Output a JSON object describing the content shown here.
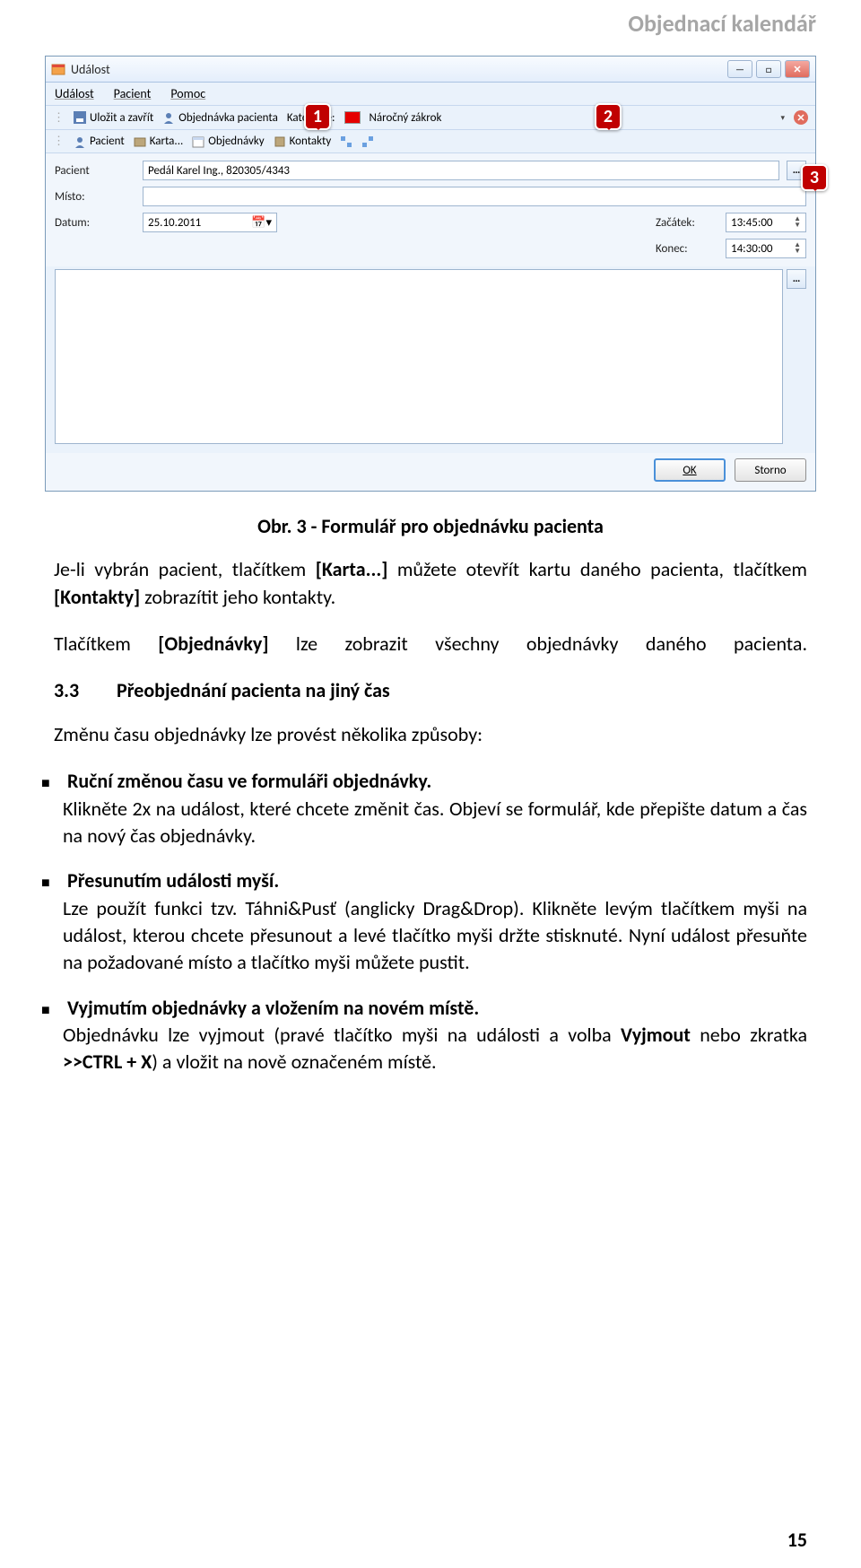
{
  "header": {
    "title": "Objednací kalendář"
  },
  "window": {
    "title": "Událost",
    "menu": {
      "udalost": "Událost",
      "pacient": "Pacient",
      "pomoc": "Pomoc"
    },
    "toolbar1": {
      "save_close": "Uložit a zavřít",
      "obj_pacienta": "Objednávka pacienta",
      "kategorie_lbl": "Kategorie:",
      "kategorie_val": "Náročný zákrok"
    },
    "toolbar2": {
      "pacient": "Pacient",
      "karta": "Karta...",
      "objednavky": "Objednávky",
      "kontakty": "Kontakty"
    },
    "form": {
      "pacient_lbl": "Pacient",
      "pacient_val": "Pedál Karel Ing., 820305/4343",
      "misto_lbl": "Místo:",
      "misto_val": "",
      "datum_lbl": "Datum:",
      "datum_val": "25.10.2011",
      "zacatek_lbl": "Začátek:",
      "zacatek_val": "13:45:00",
      "konec_lbl": "Konec:",
      "konec_val": "14:30:00"
    },
    "buttons": {
      "ok": "OK",
      "storno": "Storno"
    }
  },
  "callouts": {
    "c1": "1",
    "c2": "2",
    "c3": "3"
  },
  "text": {
    "caption": "Obr. 3 - Formulář pro objednávku pacienta",
    "p1a": "Je-li vybrán pacient, tlačítkem ",
    "p1b": "[Karta...]",
    "p1c": " můžete otevřít kartu daného pacienta, tlačítkem ",
    "p1d": "[Kontakty]",
    "p1e": " zobrazítit jeho kontakty.",
    "p2a": "Tlačítkem ",
    "p2b": "[Objednávky]",
    "p2c": " lze zobrazit všechny objednávky daného pacienta.",
    "h33_num": "3.3",
    "h33": "Přeobjednání pacienta na jiný čas",
    "p3": "Změnu času objednávky lze provést několika způsoby:",
    "li1a": "Ruční změnou času ve formuláři objednávky.",
    "li1b": "Klikněte 2x na událost, které chcete změnit čas. Objeví se formulář, kde přepište datum a čas na nový čas objednávky.",
    "li2a": "Přesunutím události myší.",
    "li2b": "Lze použít funkci tzv. Táhni&Pusť (anglicky Drag&Drop). Klikněte levým tlačítkem myši na událost, kterou chcete přesunout a levé tlačítko myši držte stisknuté. Nyní událost přesuňte na požadované místo a tlačítko myši můžete pustit.",
    "li3a": "Vyjmutím objednávky a vložením na novém místě.",
    "li3b1": "Objednávku lze vyjmout (pravé tlačítko myši na události a volba ",
    "li3b2": "Vyjmout",
    "li3b3": " nebo zkratka ",
    "li3b4": ">>CTRL + X",
    "li3b5": ") a vložit na nově označeném místě."
  },
  "page_number": "15"
}
